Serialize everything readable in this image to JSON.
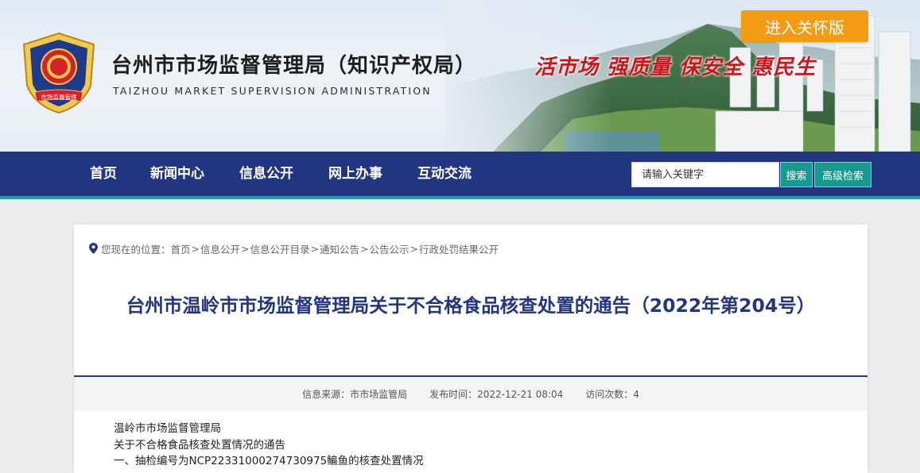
{
  "header": {
    "site_title": "台州市市场监督管理局（知识产权局）",
    "site_subtitle": "TAIZHOU MARKET SUPERVISION ADMINISTRATION",
    "emblem_text": "市场监督管理",
    "slogan": "活市场  强质量  保安全  惠民生",
    "care_button": "进入关怀版"
  },
  "nav": {
    "items": [
      "首页",
      "新闻中心",
      "信息公开",
      "网上办事",
      "互动交流"
    ]
  },
  "search": {
    "placeholder": "请输入关键字",
    "search_button": "搜索",
    "advanced_button": "高级检索"
  },
  "breadcrumb": {
    "prefix": "您现在的位置：",
    "items": [
      "首页",
      "信息公开",
      "信息公开目录",
      "通知公告",
      "公告公示",
      "行政处罚结果公开"
    ],
    "separator": ">"
  },
  "article": {
    "title": "台州市温岭市市场监督管理局关于不合格食品核查处置的通告（2022年第204号）",
    "meta": {
      "source_label": "信息来源：",
      "source": "市市场监管局",
      "time_label": "发布时间：",
      "time": "2022-12-21 08:04",
      "views_label": "访问次数：",
      "views": "4"
    },
    "paragraphs": [
      "温岭市市场监督管理局",
      "关于不合格食品核查处置情况的通告",
      "一、抽检编号为NCP22331000274730975鳊鱼的核查处置情况"
    ]
  },
  "colors": {
    "nav_bg": "#213580",
    "nav_accent": "#1ba3a3",
    "title": "#213580",
    "slogan": "#c8161d",
    "care_button": "#f39b13",
    "search_button": "#16998f"
  }
}
